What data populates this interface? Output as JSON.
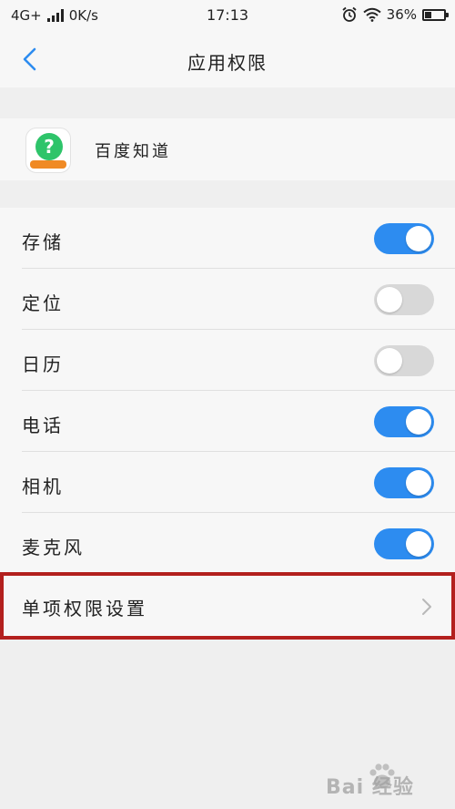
{
  "status_bar": {
    "network": "4G+",
    "speed": "0K/s",
    "time": "17:13",
    "battery": "36%",
    "battery_level": 0.36
  },
  "header": {
    "title": "应用权限",
    "back_icon": "chevron-left-icon"
  },
  "app": {
    "name": "百度知道",
    "icon_glyph": "?"
  },
  "permissions": [
    {
      "label": "存储",
      "enabled": true
    },
    {
      "label": "定位",
      "enabled": false
    },
    {
      "label": "日历",
      "enabled": false
    },
    {
      "label": "电话",
      "enabled": true
    },
    {
      "label": "相机",
      "enabled": true
    },
    {
      "label": "麦克风",
      "enabled": true
    }
  ],
  "single_permission": {
    "label": "单项权限设置",
    "icon": "chevron-right-icon"
  },
  "watermark": {
    "text": "Bai 经验"
  },
  "colors": {
    "accent": "#2d8cf0",
    "toggle_off": "#d8d8d8",
    "highlight_border": "#b3201e",
    "background": "#efefef",
    "surface": "#f7f7f7"
  }
}
